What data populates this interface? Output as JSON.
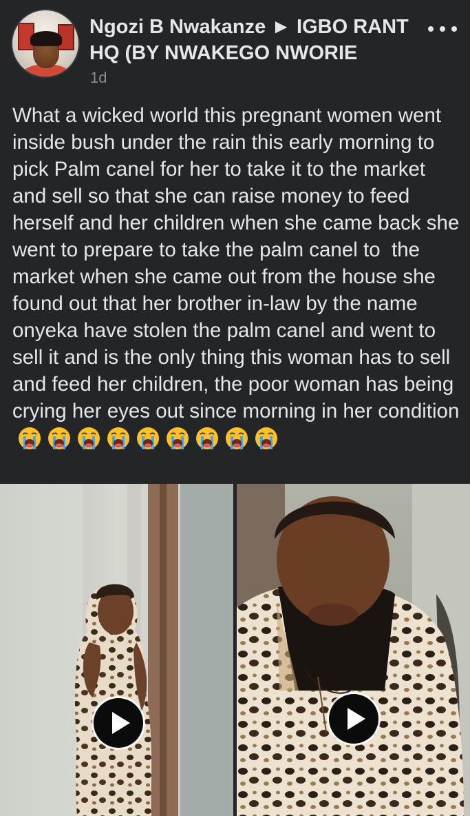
{
  "post": {
    "author_line": "Ngozi B Nwakanze ► IGBO RANT HQ (BY NWAKEGO NWORIE",
    "time": "1d",
    "body": "What a wicked world this pregnant women went inside bush under the rain this early morning to pick Palm canel for her to take it to the market and sell so that she can raise money to feed herself and her children when she came back she went to prepare to take the palm canel to  the market when she came out from the house she found out that her brother in-law by the name onyeka have stolen the palm canel and went to sell it and is the only thing this woman has to sell and feed her children, the poor woman has being crying her eyes out since morning in her condition",
    "emoji_count": 9,
    "emoji_icon": "loudly-crying-face-icon"
  },
  "icons": {
    "more": "more-dots-icon",
    "play": "play-icon"
  },
  "colors": {
    "background": "#242526",
    "text": "#e4e6eb",
    "secondary_text": "#8a8d91",
    "emoji_face": "#fbc02d",
    "emoji_tears": "#42a5f5"
  },
  "media": {
    "videos": [
      {
        "name": "video-left"
      },
      {
        "name": "video-right"
      }
    ]
  }
}
